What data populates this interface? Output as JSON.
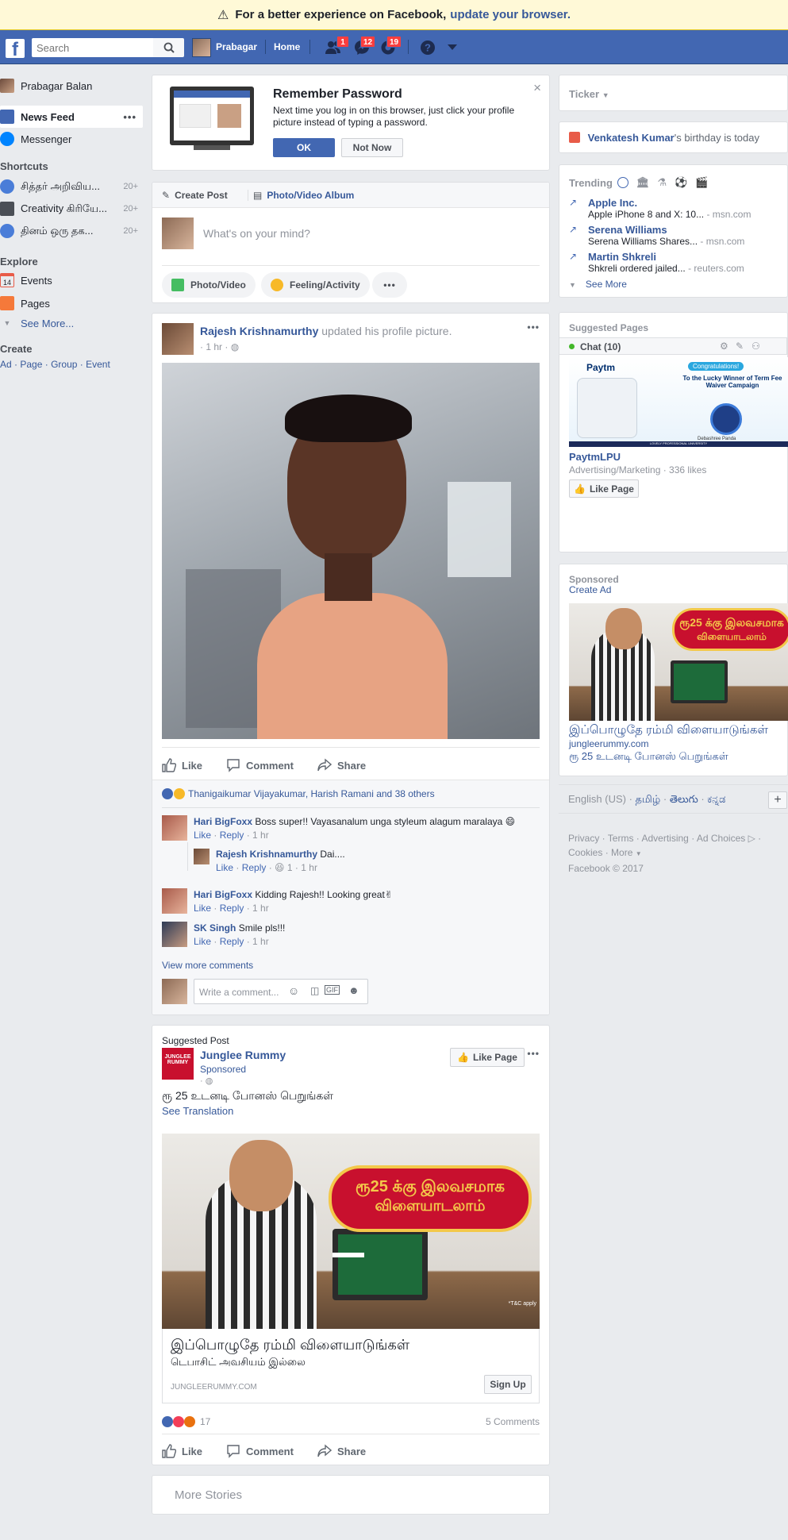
{
  "banner": {
    "text": "For a better experience on Facebook,",
    "link": "update your browser."
  },
  "topbar": {
    "search_placeholder": "Search",
    "user_name": "Prabagar",
    "home": "Home",
    "badges": {
      "friends": "1",
      "messages": "12",
      "notifications": "19"
    }
  },
  "leftnav": {
    "profile": "Prabagar Balan",
    "news_feed": "News Feed",
    "messenger": "Messenger",
    "shortcuts_title": "Shortcuts",
    "shortcuts": [
      {
        "label": "சித்தர் அறிவிய...",
        "count": "20+"
      },
      {
        "label": "Creativity கிரியே...",
        "count": "20+"
      },
      {
        "label": "தினம் ஒரு தக...",
        "count": "20+"
      }
    ],
    "explore_title": "Explore",
    "events": "Events",
    "events_day": "14",
    "pages": "Pages",
    "see_more": "See More...",
    "create_title": "Create",
    "create_links": [
      "Ad",
      "Page",
      "Group",
      "Event"
    ]
  },
  "remember": {
    "title": "Remember Password",
    "body": "Next time you log in on this browser, just click your profile picture instead of typing a password.",
    "ok": "OK",
    "not_now": "Not Now"
  },
  "composer": {
    "create_post": "Create Post",
    "album": "Photo/Video Album",
    "placeholder": "What's on your mind?",
    "photo_video": "Photo/Video",
    "feeling": "Feeling/Activity"
  },
  "post1": {
    "author": "Rajesh Krishnamurthy",
    "action": "updated his profile picture.",
    "time": "1 hr",
    "like": "Like",
    "comment": "Comment",
    "share": "Share",
    "reactors": "Thanigaikumar Vijayakumar, Harish Ramani and 38 others",
    "comments": [
      {
        "name": "Hari BigFoxx",
        "text": "Boss super!! Vayasanalum unga styleum alagum maralaya 😄",
        "time": "1 hr"
      },
      {
        "name": "Rajesh Krishnamurthy",
        "text": "Dai....",
        "time": "1 hr",
        "reaction_count": "1"
      },
      {
        "name": "Hari BigFoxx",
        "text": "Kidding Rajesh!! Looking great✌",
        "time": "1 hr"
      },
      {
        "name": "SK Singh",
        "text": "Smile pls!!!",
        "time": "1 hr"
      }
    ],
    "like_link": "Like",
    "reply_link": "Reply",
    "view_more": "View more comments",
    "write_placeholder": "Write a comment..."
  },
  "post2": {
    "label": "Suggested Post",
    "page": "Junglee Rummy",
    "sponsored": "Sponsored",
    "like_page": "Like Page",
    "text": "ரூ 25 உடனடி போனஸ் பெறுங்கள்",
    "see_translation": "See Translation",
    "ad_banner_line1": "ரூ25 க்கு இலவசமாக",
    "ad_banner_line2": "விளையாடலாம்",
    "ad_title": "இப்பொழுதே ரம்மி விளையாடுங்கள்",
    "ad_sub": "டெபாசிட் அவசியம் இல்லை",
    "ad_domain": "JUNGLEERUMMY.COM",
    "sign_up": "Sign Up",
    "tc": "*T&C apply",
    "reactions_count": "17",
    "comments_count": "5 Comments",
    "like": "Like",
    "comment": "Comment",
    "share": "Share"
  },
  "more_stories": "More Stories",
  "right": {
    "ticker": "Ticker",
    "birthday_name": "Venkatesh Kumar",
    "birthday_text": "'s birthday is today",
    "trending_title": "Trending",
    "trends": [
      {
        "title": "Apple Inc.",
        "desc": "Apple iPhone 8 and X: 10...",
        "src": "- msn.com"
      },
      {
        "title": "Serena Williams",
        "desc": "Serena Williams Shares...",
        "src": "- msn.com"
      },
      {
        "title": "Martin Shkreli",
        "desc": "Shkreli ordered jailed...",
        "src": "- reuters.com"
      }
    ],
    "see_more": "See More",
    "suggested_pages": "Suggested Pages",
    "chat": "Chat (10)",
    "paytm_brand": "Paytm",
    "paytm_congrats": "Congratulations!",
    "paytm_winner": "To the Lucky Winner of Term Fee Waiver Campaign",
    "paytm_person": "Debashree Panda",
    "paytm_univ": "LOVELY PROFESSIONAL UNIVERSITY",
    "paytm_name": "PaytmLPU",
    "paytm_meta": "Advertising/Marketing · 336 likes",
    "like_page": "Like Page",
    "sponsored": "Sponsored",
    "create_ad": "Create Ad",
    "ad_banner_line1": "ரூ25 க்கு இலவசமாக",
    "ad_banner_line2": "விளையாடலாம்",
    "ad_title": "இப்பொழுதே ரம்மி விளையாடுங்கள்",
    "ad_domain": "jungleerummy.com",
    "ad_text": "ரூ 25 உடனடி போனஸ் பெறுங்கள்",
    "languages": [
      "English (US)",
      "தமிழ்",
      "తెలుగు",
      "ಕನ್ನಡ"
    ],
    "footer_links": [
      "Privacy",
      "Terms",
      "Advertising",
      "Ad Choices",
      "Cookies",
      "More"
    ],
    "copyright": "Facebook © 2017"
  },
  "colors": {
    "fb_blue": "#4267b2",
    "link": "#365899",
    "background": "#e9ebee",
    "banner": "#fff9d7"
  }
}
